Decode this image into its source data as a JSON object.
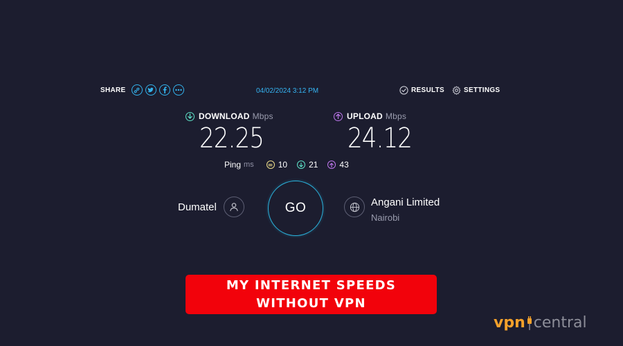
{
  "toolbar": {
    "share_label": "SHARE",
    "share_icons": [
      "link-icon",
      "twitter-icon",
      "facebook-icon",
      "more-icon"
    ],
    "timestamp": "04/02/2024 3:12 PM",
    "results_label": "RESULTS",
    "settings_label": "SETTINGS"
  },
  "download": {
    "label": "DOWNLOAD",
    "unit": "Mbps",
    "value": "22.25",
    "color": "#5ee3c8"
  },
  "upload": {
    "label": "UPLOAD",
    "unit": "Mbps",
    "value": "24.12",
    "color": "#bf78ee"
  },
  "ping": {
    "label": "Ping",
    "unit": "ms",
    "idle": "10",
    "download": "21",
    "upload": "43"
  },
  "go_label": "GO",
  "isp": {
    "name": "Dumatel"
  },
  "server": {
    "name": "Angani Limited",
    "city": "Nairobi"
  },
  "banner": {
    "line1": "MY INTERNET SPEEDS",
    "line2": "WITHOUT VPN",
    "color": "#f2020b"
  },
  "logo": {
    "part1": "vpn",
    "part2": "central",
    "accent": "#f3a12b"
  }
}
